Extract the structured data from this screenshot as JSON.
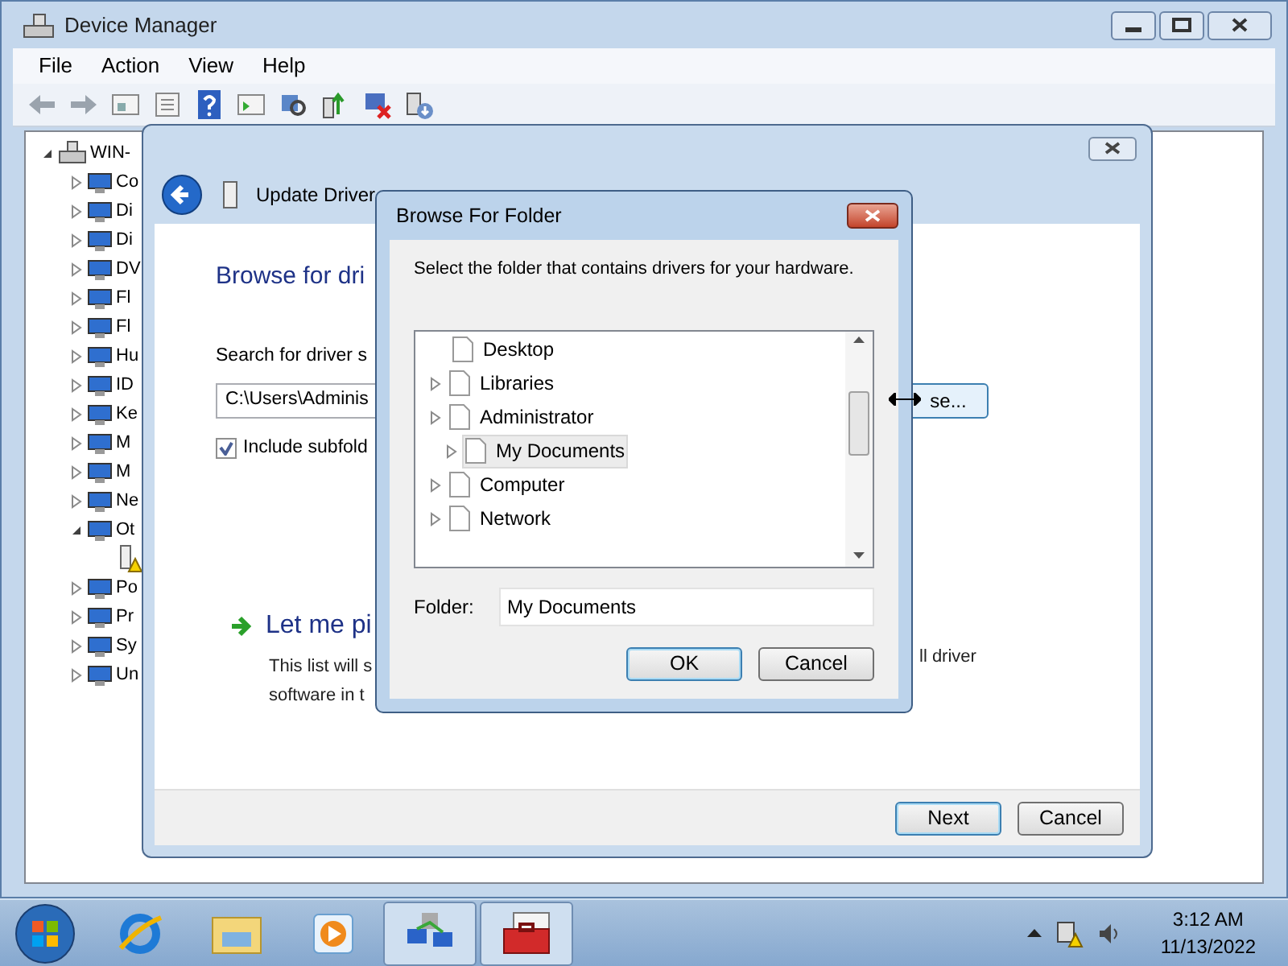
{
  "device_manager": {
    "title": "Device Manager",
    "menu": [
      "File",
      "Action",
      "View",
      "Help"
    ],
    "tree": {
      "label": "WIN-",
      "expanded": true,
      "children": [
        {
          "label": "Co",
          "expanded": false
        },
        {
          "label": "Di",
          "expanded": false
        },
        {
          "label": "Di",
          "expanded": false
        },
        {
          "label": "DV",
          "expanded": false
        },
        {
          "label": "Fl",
          "expanded": false
        },
        {
          "label": "Fl",
          "expanded": false
        },
        {
          "label": "Hu",
          "expanded": false
        },
        {
          "label": "ID",
          "expanded": false
        },
        {
          "label": "Ke",
          "expanded": false
        },
        {
          "label": "M",
          "expanded": false
        },
        {
          "label": "M",
          "expanded": false
        },
        {
          "label": "Ne",
          "expanded": false
        },
        {
          "label": "Ot",
          "expanded": true,
          "children": [
            {
              "kind": "warning-device"
            }
          ]
        },
        {
          "label": "Po",
          "expanded": false
        },
        {
          "label": "Pr",
          "expanded": false
        },
        {
          "label": "Sy",
          "expanded": false
        },
        {
          "label": "Un",
          "expanded": false
        }
      ]
    }
  },
  "update_driver": {
    "title": "Update Driver",
    "heading": "Browse for dri",
    "search_label": "Search for driver s",
    "path_value": "C:\\Users\\Adminis",
    "browse_button": "se...",
    "include_subfolders": {
      "label": "Include subfold",
      "checked": true
    },
    "pick_option": {
      "title": "Let me pi",
      "description_lines": [
        "This list will s",
        "software in t"
      ],
      "description_tail": "ll driver"
    },
    "buttons": [
      {
        "label": "Next",
        "default": true
      },
      {
        "label": "Cancel",
        "default": false
      }
    ]
  },
  "browse_folder": {
    "title": "Browse For Folder",
    "instruction": "Select the folder that contains drivers for your hardware.",
    "folders": [
      {
        "label": "Desktop",
        "expander": false,
        "selected": false,
        "children": [
          {
            "label": "Libraries",
            "expander": true,
            "selected": false
          },
          {
            "label": "Administrator",
            "expander": true,
            "selected": false,
            "children": [
              {
                "label": "My Documents",
                "expander": true,
                "selected": true
              }
            ]
          },
          {
            "label": "Computer",
            "expander": true,
            "selected": false
          },
          {
            "label": "Network",
            "expander": true,
            "selected": false
          }
        ]
      }
    ],
    "folder_label": "Folder:",
    "folder_value": "My Documents",
    "buttons": [
      {
        "label": "OK",
        "default": true
      },
      {
        "label": "Cancel",
        "default": false
      }
    ]
  },
  "taskbar": {
    "apps": [
      {
        "kind": "browser",
        "active": false
      },
      {
        "kind": "folders",
        "active": false
      },
      {
        "kind": "media",
        "active": false
      },
      {
        "kind": "network",
        "active": true
      },
      {
        "kind": "toolbox",
        "active": true
      }
    ],
    "time": "3:12 AM",
    "date": "11/13/2022"
  }
}
